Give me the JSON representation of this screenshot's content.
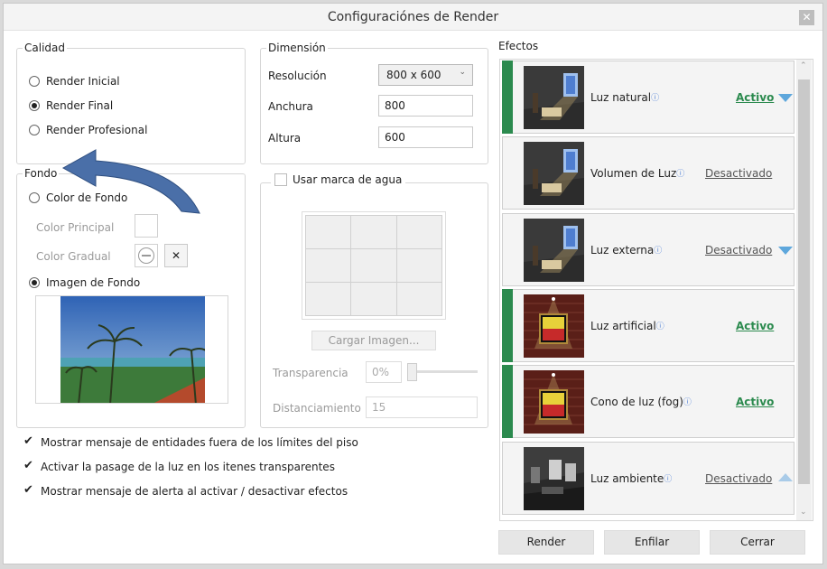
{
  "window": {
    "title": "Configuraciónes de Render"
  },
  "calidad": {
    "legend": "Calidad",
    "options": [
      {
        "label": "Render Inicial",
        "selected": false
      },
      {
        "label": "Render Final",
        "selected": true
      },
      {
        "label": "Render Profesional",
        "selected": false
      }
    ]
  },
  "dimension": {
    "legend": "Dimensión",
    "resolution_label": "Resolución",
    "resolution_value": "800 x 600",
    "width_label": "Anchura",
    "width_value": "800",
    "height_label": "Altura",
    "height_value": "600"
  },
  "fondo": {
    "legend": "Fondo",
    "color_option": "Color de Fondo",
    "principal_label": "Color Principal",
    "gradual_label": "Color Gradual",
    "image_option": "Imagen de Fondo",
    "clear_symbol": "✕"
  },
  "watermark": {
    "label": "Usar marca de agua",
    "load_button": "Cargar Imagen...",
    "transparency_label": "Transparencia",
    "transparency_value": "0%",
    "distance_label": "Distanciamiento",
    "distance_value": "15"
  },
  "options": [
    {
      "label": "Mostrar mensaje de entidades fuera de los límites del piso",
      "checked": true
    },
    {
      "label": "Activar la pasage de la luz en los itenes transparentes",
      "checked": true
    },
    {
      "label": "Mostrar mensaje de alerta al activar / desactivar efectos",
      "checked": true
    }
  ],
  "effects": {
    "title": "Efectos",
    "info_glyph": "ⓘ",
    "items": [
      {
        "name": "Luz natural",
        "status": "Activo",
        "active": true,
        "arrow": "down",
        "thumb": "room"
      },
      {
        "name": "Volumen de Luz",
        "status": "Desactivado",
        "active": false,
        "arrow": "",
        "thumb": "room"
      },
      {
        "name": "Luz externa",
        "status": "Desactivado",
        "active": false,
        "arrow": "down",
        "thumb": "room"
      },
      {
        "name": "Luz artificial",
        "status": "Activo",
        "active": true,
        "arrow": "",
        "thumb": "painting"
      },
      {
        "name": "Cono de luz (fog)",
        "status": "Activo",
        "active": true,
        "arrow": "",
        "thumb": "painting"
      },
      {
        "name": "Luz ambiente",
        "status": "Desactivado",
        "active": false,
        "arrow": "up",
        "thumb": "dark"
      }
    ]
  },
  "buttons": {
    "render": "Render",
    "enfilar": "Enfilar",
    "cerrar": "Cerrar"
  },
  "colors": {
    "active": "#2b8a4e",
    "accent_arrow": "#5ea7dc"
  }
}
